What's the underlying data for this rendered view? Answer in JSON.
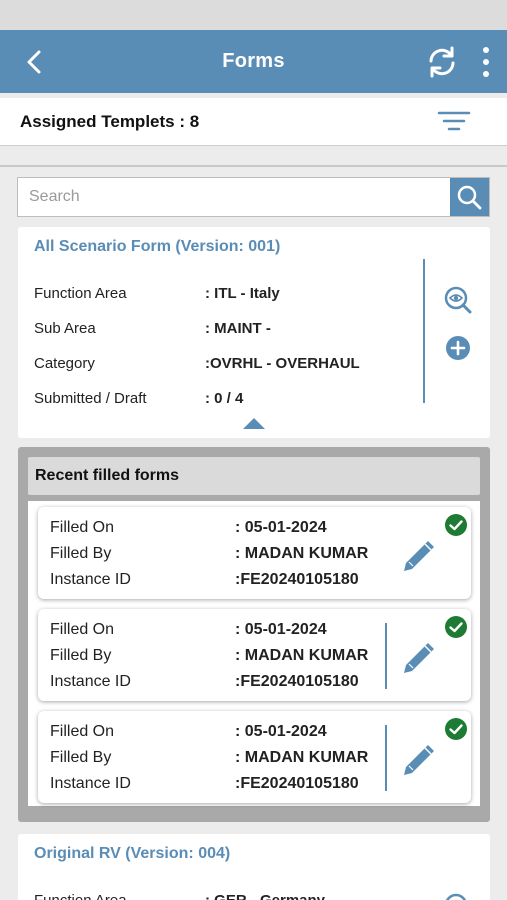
{
  "app": {
    "title": "Forms"
  },
  "assigned": {
    "label": "Assigned Templets : 8"
  },
  "search": {
    "placeholder": "Search"
  },
  "forms": [
    {
      "title": "All Scenario Form (Version: 001)",
      "fields": [
        {
          "label": "Function Area",
          "value": ": ITL - Italy"
        },
        {
          "label": "Sub Area",
          "value": ": MAINT -"
        },
        {
          "label": "Category",
          "value": ":OVRHL - OVERHAUL"
        },
        {
          "label": "Submitted / Draft",
          "value": ": 0 / 4"
        }
      ]
    },
    {
      "title": "Original RV (Version: 004)",
      "fields": [
        {
          "label": "Function Area",
          "value": ": GER - Germany"
        }
      ]
    }
  ],
  "recent": {
    "title": "Recent filled forms",
    "items": [
      {
        "filled_on_label": "Filled On",
        "filled_on": ": 05-01-2024",
        "filled_by_label": "Filled By",
        "filled_by": ": MADAN KUMAR",
        "instance_label": "Instance ID",
        "instance_id": ":FE20240105180"
      },
      {
        "filled_on_label": "Filled On",
        "filled_on": ": 05-01-2024",
        "filled_by_label": "Filled By",
        "filled_by": ": MADAN KUMAR",
        "instance_label": "Instance ID",
        "instance_id": ":FE20240105180"
      },
      {
        "filled_on_label": "Filled On",
        "filled_on": ": 05-01-2024",
        "filled_by_label": "Filled By",
        "filled_by": ": MADAN KUMAR",
        "instance_label": "Instance ID",
        "instance_id": ":FE20240105180"
      }
    ]
  },
  "icons": {
    "back": "chevron-left-icon",
    "sync": "sync-icon",
    "more": "more-vertical-icon",
    "filter": "filter-icon",
    "search": "search-icon",
    "view": "eye-zoom-icon",
    "add": "plus-circle-icon",
    "edit": "pencil-icon",
    "status": "check-circle-icon"
  },
  "colors": {
    "primary": "#5a8db6",
    "success": "#1e7b34",
    "panel": "#a9a9a9"
  }
}
